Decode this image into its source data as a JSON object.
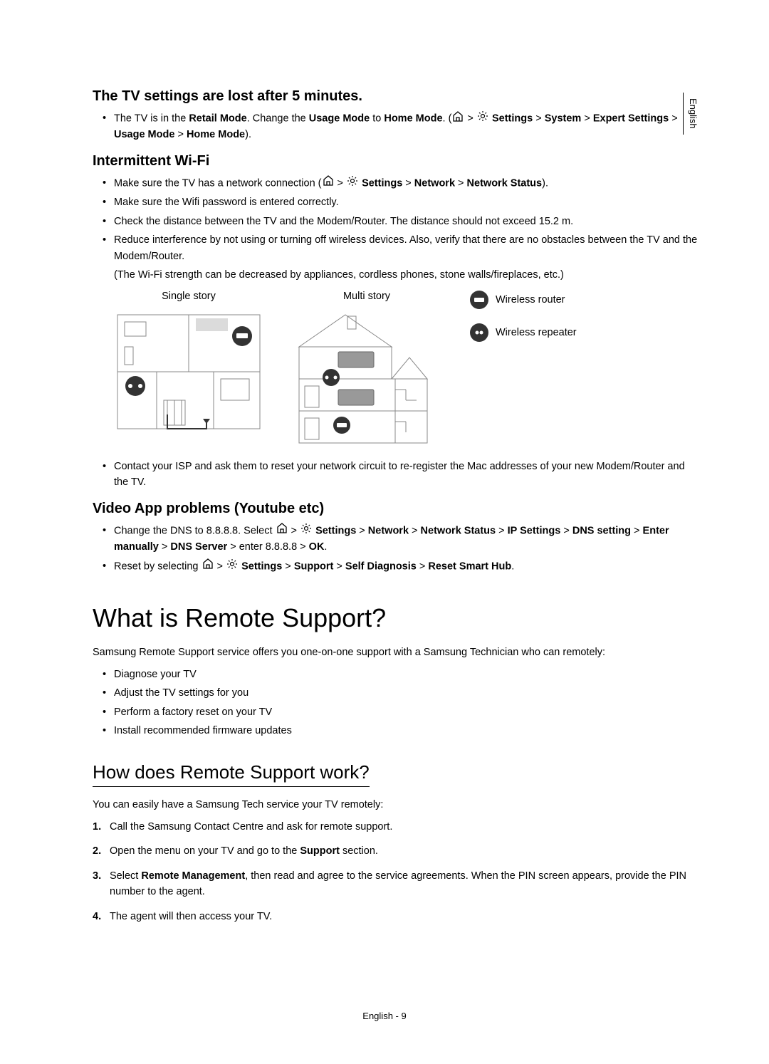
{
  "sideTab": "English",
  "section1": {
    "title": "The TV settings are lost after 5 minutes.",
    "bullet1_part1": "The TV is in the ",
    "bullet1_bold1": "Retail Mode",
    "bullet1_part2": ". Change the ",
    "bullet1_bold2": "Usage Mode",
    "bullet1_part3": " to ",
    "bullet1_bold3": "Home Mode",
    "bullet1_part4": ". (",
    "bullet1_part5": " > ",
    "bullet1_bold4": "Settings",
    "bullet1_part6": " > ",
    "bullet1_bold5": "System",
    "bullet1_part7": " > ",
    "bullet1_bold6": "Expert Settings",
    "bullet1_part8": " > ",
    "bullet1_bold7": "Usage Mode",
    "bullet1_part9": " > ",
    "bullet1_bold8": "Home Mode",
    "bullet1_part10": ")."
  },
  "section2": {
    "title": "Intermittent Wi-Fi",
    "b1_part1": "Make sure the TV has a network connection (",
    "b1_part2": " > ",
    "b1_bold1": "Settings",
    "b1_part3": " > ",
    "b1_bold2": "Network",
    "b1_part4": " > ",
    "b1_bold3": "Network Status",
    "b1_part5": ").",
    "b2": "Make sure the Wifi password is entered correctly.",
    "b3": "Check the distance between the TV and the Modem/Router. The distance should not exceed 15.2 m.",
    "b4": "Reduce interference by not using or turning off wireless devices. Also, verify that there are no obstacles between the TV and the Modem/Router.",
    "note": "(The Wi-Fi strength can be decreased by appliances, cordless phones, stone walls/fireplaces, etc.)",
    "diag1Label": "Single story",
    "diag2Label": "Multi story",
    "legend1": "Wireless router",
    "legend2": "Wireless repeater",
    "b5": "Contact your ISP and ask them to reset your network circuit to re-register the Mac addresses of your new Modem/Router and the TV."
  },
  "section3": {
    "title": "Video App problems (Youtube etc)",
    "b1_part1": "Change the DNS to 8.8.8.8. Select ",
    "b1_part2": " > ",
    "b1_bold1": "Settings",
    "b1_part3": " > ",
    "b1_bold2": "Network",
    "b1_part4": " > ",
    "b1_bold3": "Network Status",
    "b1_part5": " > ",
    "b1_bold4": "IP Settings",
    "b1_part6": " > ",
    "b1_bold5": "DNS setting",
    "b1_part7": " > ",
    "b1_bold6": "Enter manually",
    "b1_part8": " > ",
    "b1_bold7": "DNS Server",
    "b1_part9": " > enter 8.8.8.8 > ",
    "b1_bold8": "OK",
    "b1_part10": ".",
    "b2_part1": "Reset by selecting ",
    "b2_part2": " > ",
    "b2_bold1": "Settings",
    "b2_part3": " > ",
    "b2_bold2": "Support",
    "b2_part4": " > ",
    "b2_bold3": "Self Diagnosis",
    "b2_part5": " > ",
    "b2_bold4": "Reset Smart Hub",
    "b2_part6": "."
  },
  "mainTitle": "What is Remote Support?",
  "intro": "Samsung Remote Support service offers you one-on-one support with a Samsung Technician who can remotely:",
  "introBullets": {
    "b1": "Diagnose your TV",
    "b2": "Adjust the TV settings for you",
    "b3": "Perform a factory reset on your TV",
    "b4": "Install recommended firmware updates"
  },
  "subTitle": "How does Remote Support work?",
  "subIntro": "You can easily have a Samsung Tech service your TV remotely:",
  "steps": {
    "s1": "Call the Samsung Contact Centre and ask for remote support.",
    "s2_part1": "Open the menu on your TV and go to the ",
    "s2_bold": "Support",
    "s2_part2": " section.",
    "s3_part1": "Select ",
    "s3_bold": "Remote Management",
    "s3_part2": ", then read and agree to the service agreements. When the PIN screen appears, provide the PIN number to the agent.",
    "s4": "The agent will then access your TV."
  },
  "footer": "English - 9"
}
